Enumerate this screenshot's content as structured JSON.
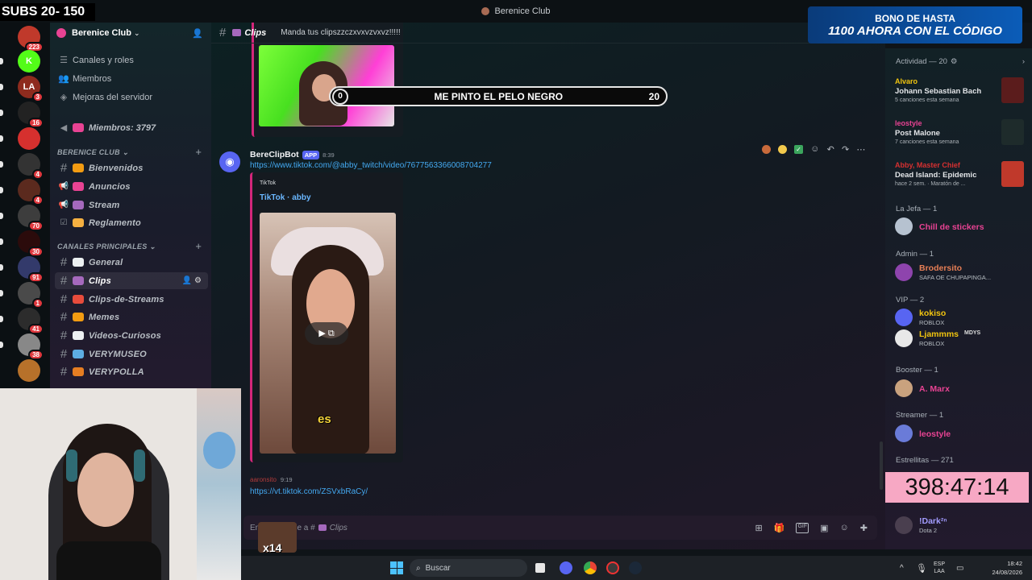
{
  "overlay": {
    "subs_counter": "SUBS 20- 150",
    "promo_line1": "BONO DE HASTA",
    "promo_line2": "1100 AHORA CON EL CÓDIGO",
    "timer": "398:47:14",
    "poll_left": "0",
    "poll_text": "ME PINTO EL PELO NEGRO",
    "poll_right": "20",
    "sticker_text": "x14"
  },
  "window": {
    "title": "Berenice Club"
  },
  "servers": [
    {
      "badge": "223",
      "color": "#c0392b"
    },
    {
      "badge": "",
      "color": "#53fc18",
      "label": "K"
    },
    {
      "badge": "3",
      "color": "#8e2b1e",
      "label": "LA"
    },
    {
      "badge": "16",
      "color": "#222"
    },
    {
      "badge": "",
      "color": "#d6302e"
    },
    {
      "badge": "4",
      "color": "#333"
    },
    {
      "badge": "4",
      "color": "#5b2a1e"
    },
    {
      "badge": "70",
      "color": "#3d3d3d"
    },
    {
      "badge": "30",
      "color": "#2b0b0b"
    },
    {
      "badge": "91",
      "color": "#333a6b"
    },
    {
      "badge": "1",
      "color": "#4a4a4a"
    },
    {
      "badge": "41",
      "color": "#2c2c2c"
    },
    {
      "badge": "38",
      "color": "#888"
    },
    {
      "badge": "",
      "color": "#b7712a"
    }
  ],
  "sidebar": {
    "server_name": "Berenice Club",
    "top_items": [
      {
        "label": "Canales y roles",
        "icon": "list-icon"
      },
      {
        "label": "Miembros",
        "icon": "members-icon"
      },
      {
        "label": "Mejoras del servidor",
        "icon": "boost-icon"
      }
    ],
    "members_channel": "Miembros: 3797",
    "categories": [
      {
        "name": "BERENICE CLUB",
        "channels": [
          {
            "name": "Bienvenidos",
            "emoji_color": "#f39c12",
            "kind": "text"
          },
          {
            "name": "Anuncios",
            "emoji_color": "#e84393",
            "kind": "announce"
          },
          {
            "name": "Stream",
            "emoji_color": "#a569bd",
            "kind": "announce"
          },
          {
            "name": "Reglamento",
            "emoji_color": "#f5b041",
            "kind": "rules"
          }
        ]
      },
      {
        "name": "CANALES PRINCIPALES",
        "channels": [
          {
            "name": "General",
            "emoji_color": "#ecf0f1",
            "kind": "text"
          },
          {
            "name": "Clips",
            "emoji_color": "#a569bd",
            "kind": "text",
            "active": true
          },
          {
            "name": "Clips-de-Streams",
            "emoji_color": "#e74c3c",
            "kind": "text"
          },
          {
            "name": "Memes",
            "emoji_color": "#f39c12",
            "kind": "text"
          },
          {
            "name": "Videos-Curiosos",
            "emoji_color": "#ecf0f1",
            "kind": "text"
          },
          {
            "name": "VERYMUSEO",
            "emoji_color": "#5dade2",
            "kind": "text"
          },
          {
            "name": "VERYPOLLA",
            "emoji_color": "#e67e22",
            "kind": "text"
          }
        ]
      }
    ]
  },
  "chat_header": {
    "channel": "Clips",
    "topic": "Manda tus clipszzczxvxvzvxvz!!!!!"
  },
  "messages": [
    {
      "author": "BereClipBot",
      "tag": "APP",
      "time": "8:39",
      "link": "https://www.tiktok.com/@abby_twitch/video/7677563366008704277",
      "embed_provider": "TikTok",
      "embed_title": "TikTok · abby",
      "video_caption": "es"
    },
    {
      "author": "aaronsito",
      "time": "9:19",
      "link": "https://vt.tiktok.com/ZSVxbRaCy/"
    }
  ],
  "composer": {
    "placeholder": "Enviar mensaje a #",
    "placeholder_prefix": "En",
    "placeholder_mid": "je a #",
    "channel": "Clips"
  },
  "member_list": {
    "activity_header": "Actividad — 20",
    "activities": [
      {
        "user": "Alvaro",
        "user_color": "#f1c40f",
        "title": "Johann Sebastian Bach",
        "sub": "5 canciones esta semana",
        "thumb": "#5b1c1c"
      },
      {
        "user": "leostyle",
        "user_color": "#e84393",
        "title": "Post Malone",
        "sub": "7 canciones esta semana",
        "thumb": "#1e2b2b"
      },
      {
        "user": "Abby, Master Chief",
        "user_color": "#d63031",
        "title": "Dead Island: Epidemic",
        "sub": "hace 2 sem. · Maratón de ...",
        "thumb": "#c0392b"
      }
    ],
    "groups": [
      {
        "role": "La Jefa",
        "count": "1",
        "members": [
          {
            "name": "Chill de stickers",
            "color": "#e84393",
            "status": ""
          }
        ]
      },
      {
        "role": "Admin",
        "count": "1",
        "members": [
          {
            "name": "Brodersito",
            "color": "#e67e55",
            "status": "SAFA OE CHUPAPINGA..."
          }
        ]
      },
      {
        "role": "VIP",
        "count": "2",
        "members": [
          {
            "name": "kokiso",
            "color": "#f1c40f",
            "status": "ROBLOX"
          },
          {
            "name": "Ljammms",
            "color": "#f1c40f",
            "status": "ROBLOX",
            "tag": "MDYS"
          }
        ]
      },
      {
        "role": "Booster",
        "count": "1",
        "members": [
          {
            "name": "A. Marx",
            "color": "#e84393",
            "status": ""
          }
        ]
      },
      {
        "role": "Streamer",
        "count": "1",
        "members": [
          {
            "name": "leostyle",
            "color": "#e84393",
            "status": ""
          }
        ]
      },
      {
        "role": "Estrellitas",
        "count": "271",
        "members": [
          {
            "name": "!Dark²ⁿ",
            "color": "#a29bfe",
            "status": "Dota 2"
          }
        ]
      }
    ]
  },
  "taskbar": {
    "search_placeholder": "Buscar",
    "lang": "ESP",
    "lang_sub": "LAA",
    "time": "18:42",
    "date": "24/08/2026"
  }
}
